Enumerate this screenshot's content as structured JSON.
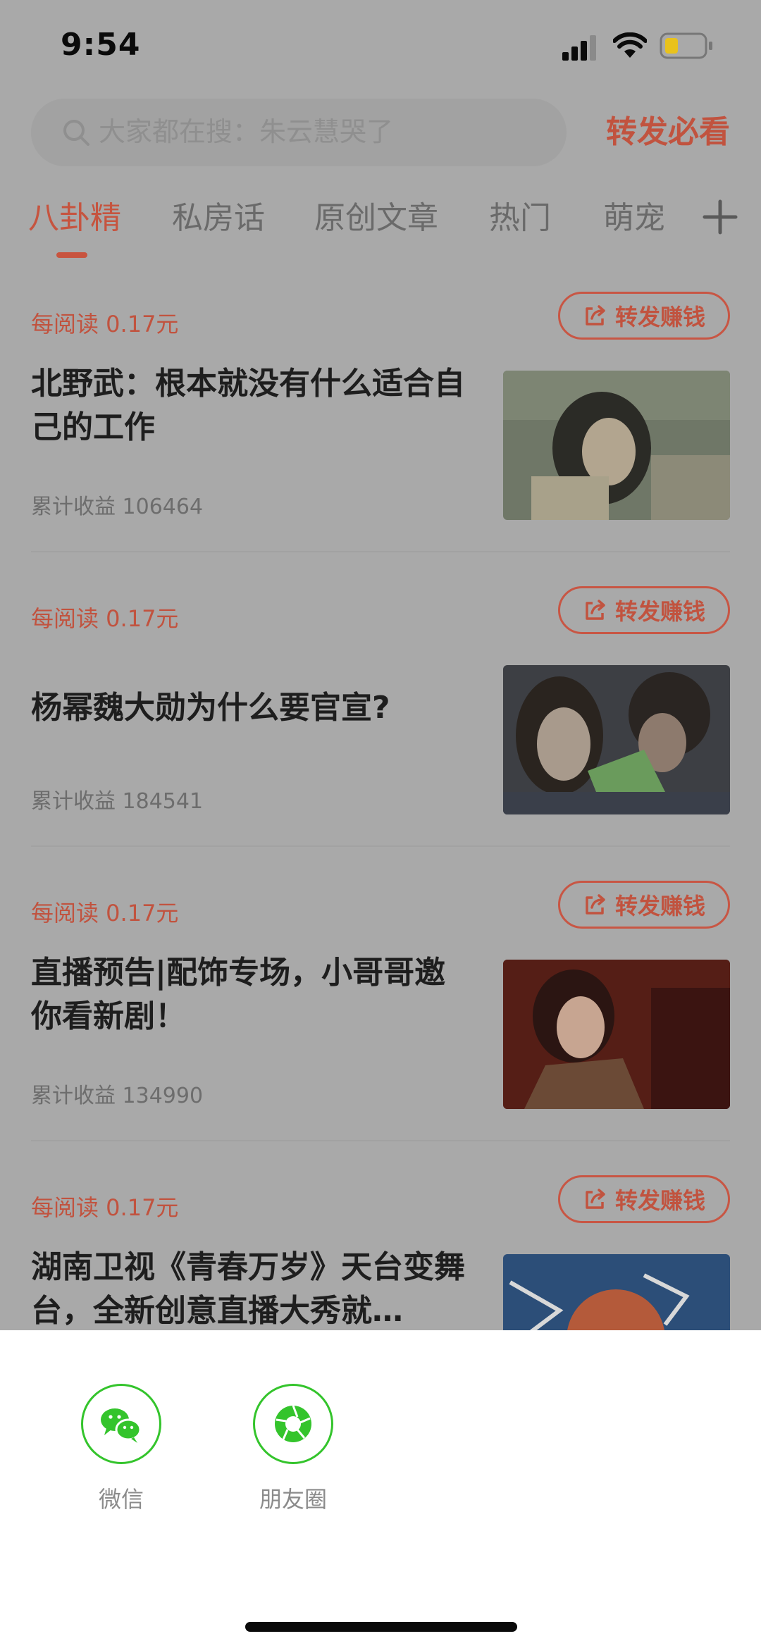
{
  "status_bar": {
    "time": "9:54",
    "icons": [
      "signal-icon",
      "wifi-icon",
      "battery-icon"
    ]
  },
  "search": {
    "placeholder": "大家都在搜：朱云慧哭了",
    "action": "转发必看"
  },
  "tabs": [
    {
      "label": "八卦精",
      "active": true
    },
    {
      "label": "私房话",
      "active": false
    },
    {
      "label": "原创文章",
      "active": false
    },
    {
      "label": "热门",
      "active": false
    },
    {
      "label": "萌宠",
      "active": false
    }
  ],
  "articles": [
    {
      "per_read": "每阅读 0.17元",
      "share_label": "转发赚钱",
      "title": "北野武：根本就没有什么适合自己的工作",
      "earnings": "累计收益 106464"
    },
    {
      "per_read": "每阅读 0.17元",
      "share_label": "转发赚钱",
      "title": "杨幂魏大勋为什么要官宣?",
      "earnings": "累计收益 184541"
    },
    {
      "per_read": "每阅读 0.17元",
      "share_label": "转发赚钱",
      "title": "直播预告|配饰专场，小哥哥邀你看新剧！",
      "earnings": "累计收益 134990"
    },
    {
      "per_read": "每阅读 0.17元",
      "share_label": "转发赚钱",
      "title": "湖南卫视《青春万岁》天台变舞台，全新创意直播大秀就…",
      "earnings": ""
    }
  ],
  "share_sheet": {
    "targets": [
      {
        "label": "微信",
        "icon": "wechat-icon"
      },
      {
        "label": "朋友圈",
        "icon": "moments-icon"
      }
    ]
  },
  "colors": {
    "accent": "#c1533f",
    "share_green": "#34c42c",
    "overlay_bg": "#a9a9a9"
  }
}
